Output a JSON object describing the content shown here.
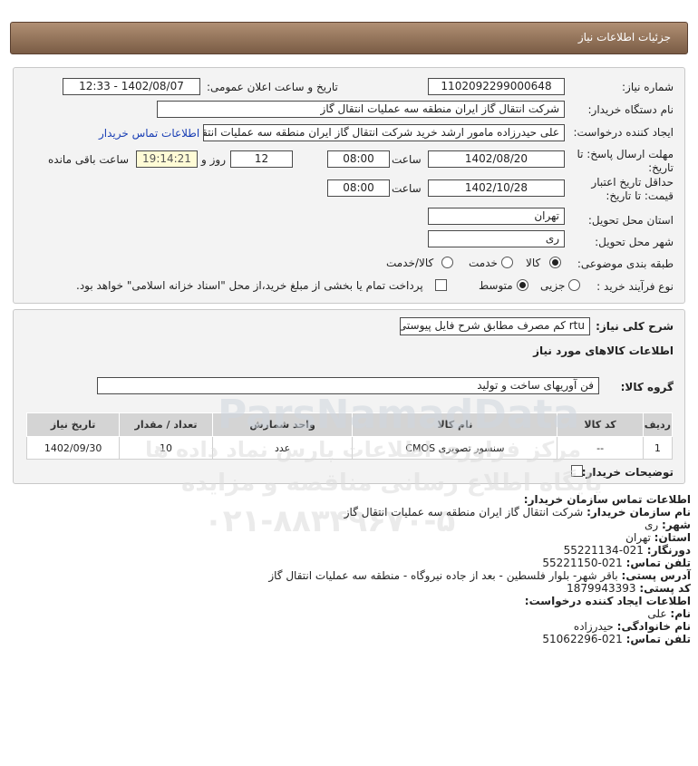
{
  "header": {
    "title": "جزئیات اطلاعات نیاز"
  },
  "form": {
    "need_number_label": "شماره نیاز:",
    "need_number": "1102092299000648",
    "announce_label": "تاریخ و ساعت اعلان عمومی:",
    "announce_value": "1402/08/07 - 12:33",
    "buyer_org_label": "نام دستگاه خریدار:",
    "buyer_org": "شرکت انتقال گاز ایران منطقه سه عملیات انتقال گاز",
    "creator_label": "ایجاد کننده درخواست:",
    "creator": "علی حیدرزاده مامور ارشد خرید شرکت انتقال گاز ایران منطقه سه عملیات انتقال",
    "contact_link": "اطلاعات تماس خریدار",
    "deadline_label_1": "مهلت ارسال پاسخ: تا",
    "deadline_label_2": "تاریخ:",
    "deadline_date": "1402/08/20",
    "time_label": "ساعت",
    "deadline_time": "08:00",
    "days_value": "12",
    "days_label": "روز و",
    "remaining_time": "19:14:21",
    "remaining_label": "ساعت باقی مانده",
    "validity_label_1": "حداقل تاریخ اعتبار",
    "validity_label_2": "قیمت: تا تاریخ:",
    "validity_date": "1402/10/28",
    "validity_time": "08:00",
    "province_label": "استان محل تحویل:",
    "province": "تهران",
    "city_label": "شهر محل تحویل:",
    "city": "ری",
    "category_label": "طبقه بندی موضوعی:",
    "category_options": [
      "کالا",
      "خدمت",
      "کالا/خدمت"
    ],
    "category_selected": "کالا",
    "process_label": "نوع فرآیند خرید :",
    "process_options": [
      "جزیی",
      "متوسط"
    ],
    "process_selected": "متوسط",
    "payment_note": "پرداخت تمام یا بخشی از مبلغ خرید،از محل \"اسناد خزانه اسلامی\" خواهد بود."
  },
  "details": {
    "summary_label": "شرح کلی نیاز:",
    "summary": "rtu کم مصرف مطابق شرح فایل پیوستی",
    "goods_info_title": "اطلاعات کالاهای مورد نیاز",
    "group_label": "گروه کالا:",
    "group_value": "فن آوریهای ساخت و تولید",
    "table": {
      "headers": [
        "ردیف",
        "کد کالا",
        "نام کالا",
        "واحد شمارش",
        "تعداد / مقدار",
        "تاریخ نیاز"
      ],
      "rows": [
        [
          "1",
          "--",
          "سنسور تصویری CMOS",
          "عدد",
          "10",
          "1402/09/30"
        ]
      ]
    },
    "buyer_notes_label": "توضیحات خریدار:"
  },
  "contact": {
    "org_title": "اطلاعات تماس سازمان خریدار:",
    "org_name_label": "نام سازمان خریدار:",
    "org_name": "شرکت انتقال گاز ایران منطقه سه عملیات انتقال گاز",
    "city_label": "شهر:",
    "city": "ری",
    "province_label": "استان:",
    "province": "تهران",
    "fax_label": "دورنگار:",
    "fax": "021-55221134",
    "phone_label": "تلفن تماس:",
    "phone": "021-55221150",
    "address_label": "آدرس پستی:",
    "address": "باقر شهر- بلوار فلسطین - بعد از جاده نیروگاه - منطقه سه عملیات انتقال گاز",
    "postal_label": "کد پستی:",
    "postal": "1879943393",
    "creator_title": "اطلاعات ایجاد کننده درخواست:",
    "first_name_label": "نام:",
    "first_name": "علی",
    "last_name_label": "نام خانوادگی:",
    "last_name": "حیدرزاده",
    "creator_phone_label": "تلفن تماس:",
    "creator_phone": "021-51062296"
  },
  "watermark": {
    "brand": "ParsNamadData",
    "line1": "مرکز فراوری اطلاعات پارس نماد داده ها",
    "line2": "پایگاه اطلاع رسانی مناقصه و مزایده",
    "phone": "۰۲۱-۸۸۳۴۹۶۷۰-۵"
  }
}
